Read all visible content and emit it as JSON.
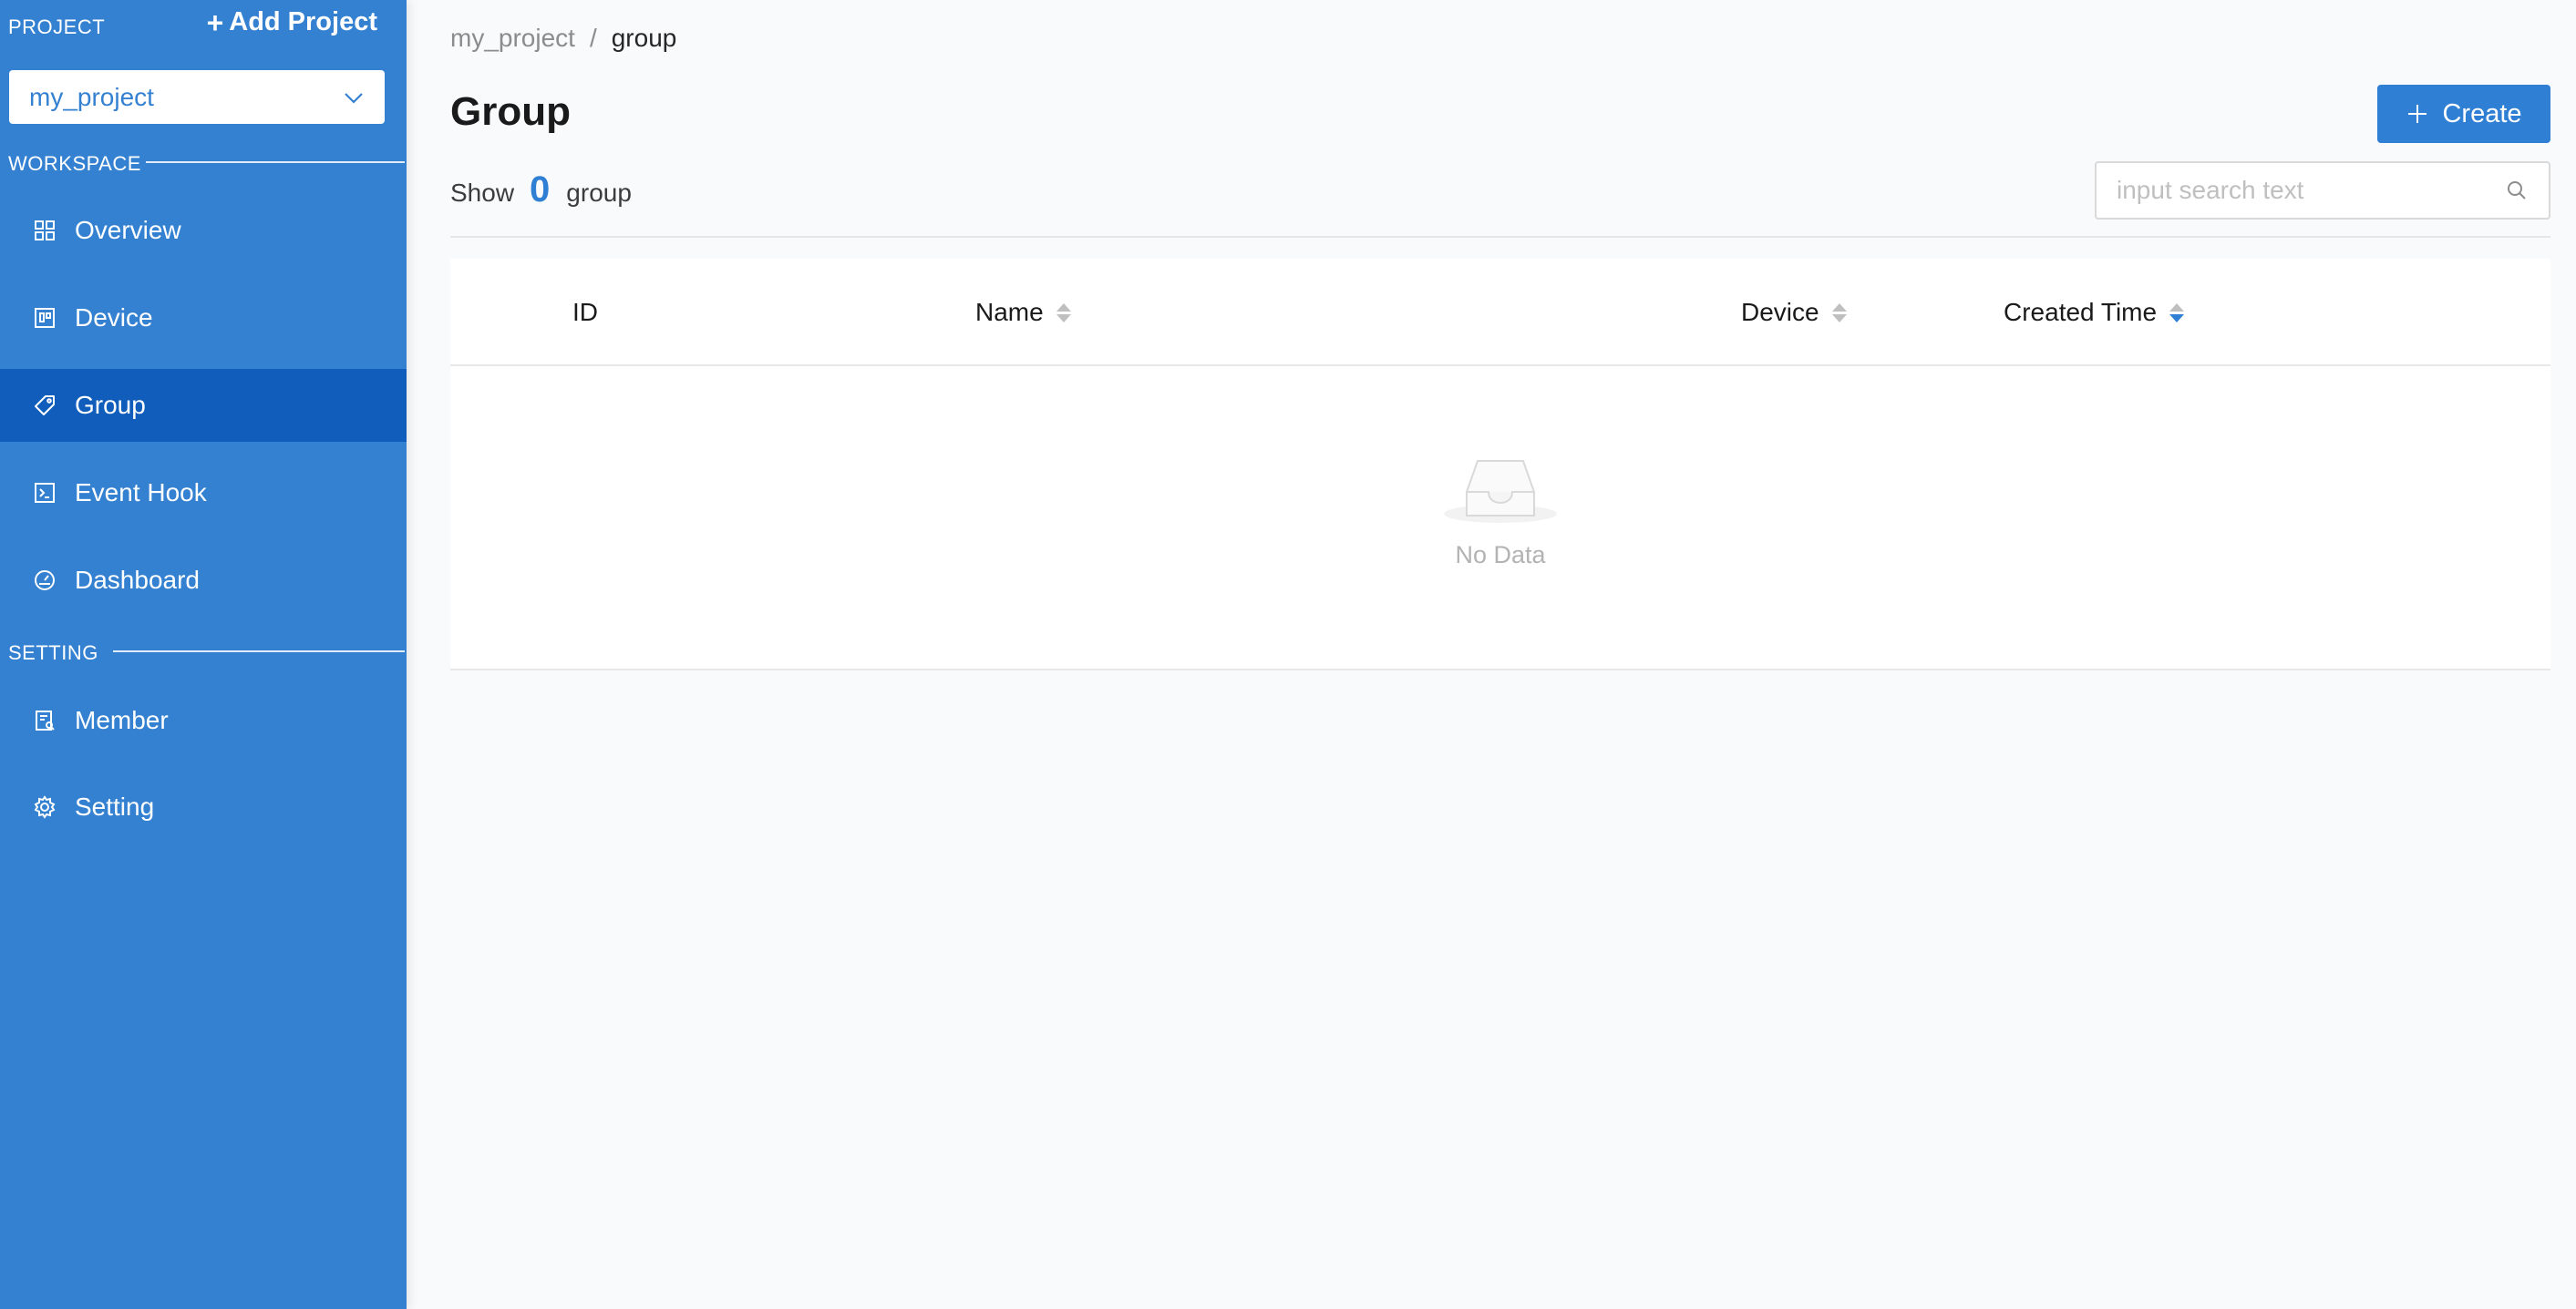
{
  "sidebar": {
    "project_label": "PROJECT",
    "add_project_label": "Add Project",
    "selected_project": "my_project",
    "workspace_label": "WORKSPACE",
    "setting_label": "SETTING",
    "workspace_items": [
      {
        "label": "Overview",
        "icon": "grid-icon"
      },
      {
        "label": "Device",
        "icon": "device-icon"
      },
      {
        "label": "Group",
        "icon": "tag-icon",
        "active": true
      },
      {
        "label": "Event Hook",
        "icon": "terminal-icon"
      },
      {
        "label": "Dashboard",
        "icon": "gauge-icon"
      }
    ],
    "setting_items": [
      {
        "label": "Member",
        "icon": "member-icon"
      },
      {
        "label": "Setting",
        "icon": "gear-icon"
      }
    ],
    "colors": {
      "background": "#3481d1",
      "active": "#105dbb"
    }
  },
  "breadcrumb": {
    "parent": "my_project",
    "separator": "/",
    "current": "group"
  },
  "page": {
    "title": "Group",
    "create_label": "Create",
    "show_prefix": "Show",
    "count": "0",
    "count_suffix": "group",
    "accent_color": "#2f7fd4"
  },
  "search": {
    "placeholder": "input search text",
    "value": ""
  },
  "table": {
    "columns": [
      {
        "label": "ID",
        "sortable": false
      },
      {
        "label": "Name",
        "sortable": true,
        "sort": "none"
      },
      {
        "label": "Device",
        "sortable": true,
        "sort": "none"
      },
      {
        "label": "Created Time",
        "sortable": true,
        "sort": "descend"
      }
    ],
    "rows": [],
    "empty_text": "No Data"
  }
}
